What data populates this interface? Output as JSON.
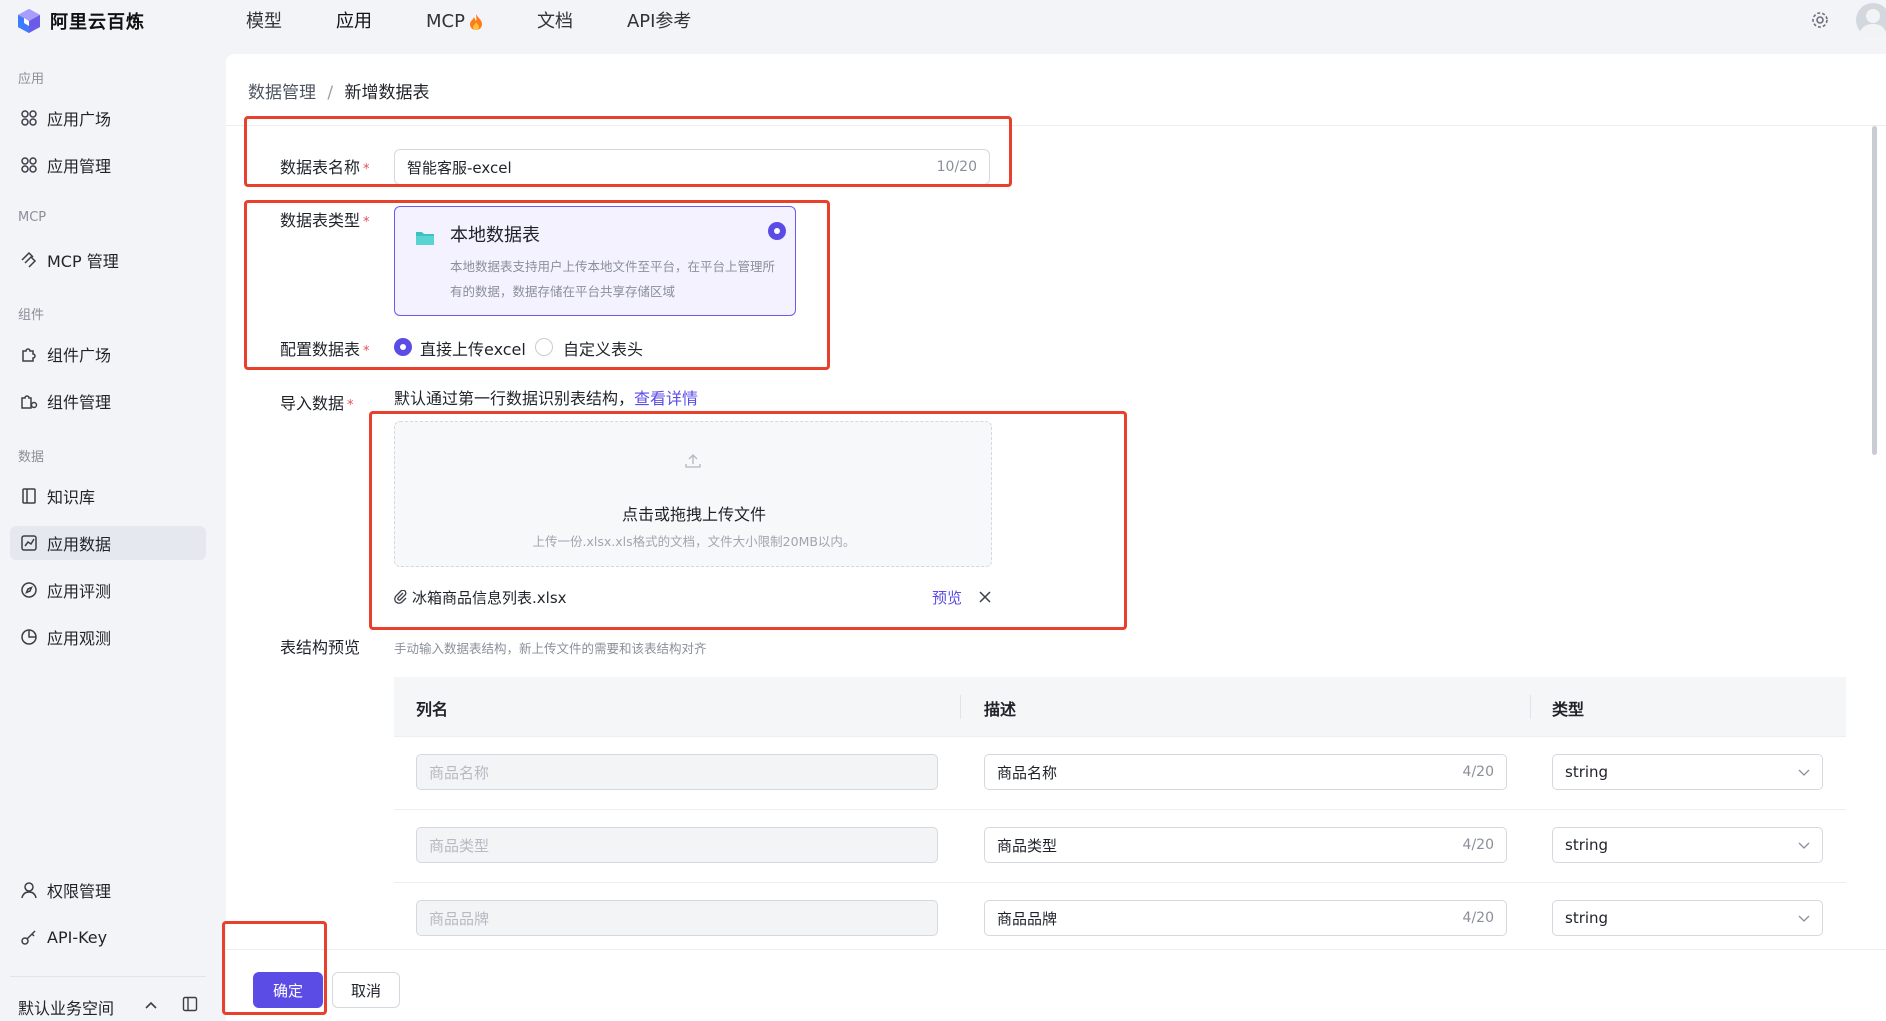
{
  "app": {
    "title": "阿里云百炼"
  },
  "topnav": {
    "items": [
      "模型",
      "应用",
      "MCP",
      "文档",
      "API参考"
    ]
  },
  "sidebar": {
    "groups": {
      "apps": "应用",
      "mcp": "MCP",
      "components": "组件",
      "data": "数据"
    },
    "items": {
      "app_plaza": "应用广场",
      "app_manage": "应用管理",
      "mcp_manage": "MCP 管理",
      "comp_plaza": "组件广场",
      "comp_manage": "组件管理",
      "knowledge": "知识库",
      "app_data": "应用数据",
      "app_eval": "应用评测",
      "app_observe": "应用观测",
      "permission": "权限管理",
      "api_key": "API-Key"
    },
    "workspace": "默认业务空间"
  },
  "breadcrumb": {
    "parent": "数据管理",
    "separator": "/",
    "current": "新增数据表"
  },
  "form": {
    "name_label": "数据表名称",
    "name_value": "智能客服-excel",
    "name_count": "10/20",
    "type_label": "数据表类型",
    "type_card_title": "本地数据表",
    "type_card_desc": "本地数据表支持用户上传本地文件至平台，在平台上管理所有的数据，数据存储在平台共享存储区域",
    "config_label": "配置数据表",
    "config_option_upload": "直接上传excel",
    "config_option_custom": "自定义表头",
    "import_label": "导入数据",
    "import_hint": "默认通过第一行数据识别表结构，",
    "import_link": "查看详情",
    "upload_title": "点击或拖拽上传文件",
    "upload_desc": "上传一份.xlsx.xls格式的文档，文件大小限制20MB以内。",
    "file_name": "冰箱商品信息列表.xlsx",
    "preview_label": "预览",
    "schema_label": "表结构预览",
    "schema_hint": "手动输入数据表结构，新上传文件的需要和该表结构对齐",
    "required_mark": "*"
  },
  "table": {
    "headers": [
      "列名",
      "描述",
      "类型"
    ],
    "rows": [
      {
        "column_placeholder": "商品名称",
        "desc": "商品名称",
        "count": "4/20",
        "type": "string"
      },
      {
        "column_placeholder": "商品类型",
        "desc": "商品类型",
        "count": "4/20",
        "type": "string"
      },
      {
        "column_placeholder": "商品品牌",
        "desc": "商品品牌",
        "count": "4/20",
        "type": "string"
      }
    ]
  },
  "footer": {
    "ok_label": "确定",
    "cancel_label": "取消"
  },
  "colors": {
    "accent": "#5b4ce6",
    "annotation_red": "#e8402c",
    "required": "#e34d59"
  }
}
